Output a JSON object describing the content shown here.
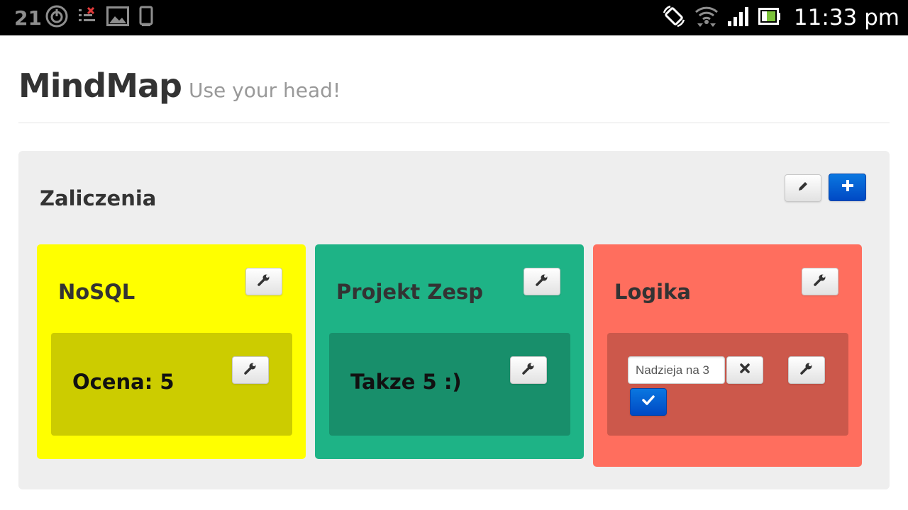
{
  "status_bar": {
    "notification_count": "21",
    "time": "11:33 pm",
    "left_icons": [
      "power-icon",
      "debug-icon",
      "gallery-icon",
      "device-icon"
    ],
    "right_icons": [
      "rotate-icon",
      "wifi-icon",
      "signal-icon",
      "battery-icon"
    ]
  },
  "header": {
    "brand": "MindMap",
    "tagline": "Use your head!"
  },
  "map": {
    "title": "Zaliczenia",
    "actions": {
      "edit_icon": "pencil-icon",
      "add_icon": "plus-icon"
    },
    "nodes": [
      {
        "title": "NoSQL",
        "color": "#ffff00",
        "child_color": "#cccc00",
        "child": {
          "text": "Ocena: 5"
        }
      },
      {
        "title": "Projekt Zesp",
        "color": "#1eb386",
        "child_color": "#188f6b",
        "child": {
          "text": "Takze 5 :)"
        }
      },
      {
        "title": "Logika",
        "color": "#ff6e5e",
        "child_color": "#cc584b",
        "child": {
          "edit_value": "Nadzieja na 3"
        }
      }
    ]
  },
  "colors": {
    "accent": "#0a6fd8",
    "panel_bg": "#eeeeee"
  }
}
